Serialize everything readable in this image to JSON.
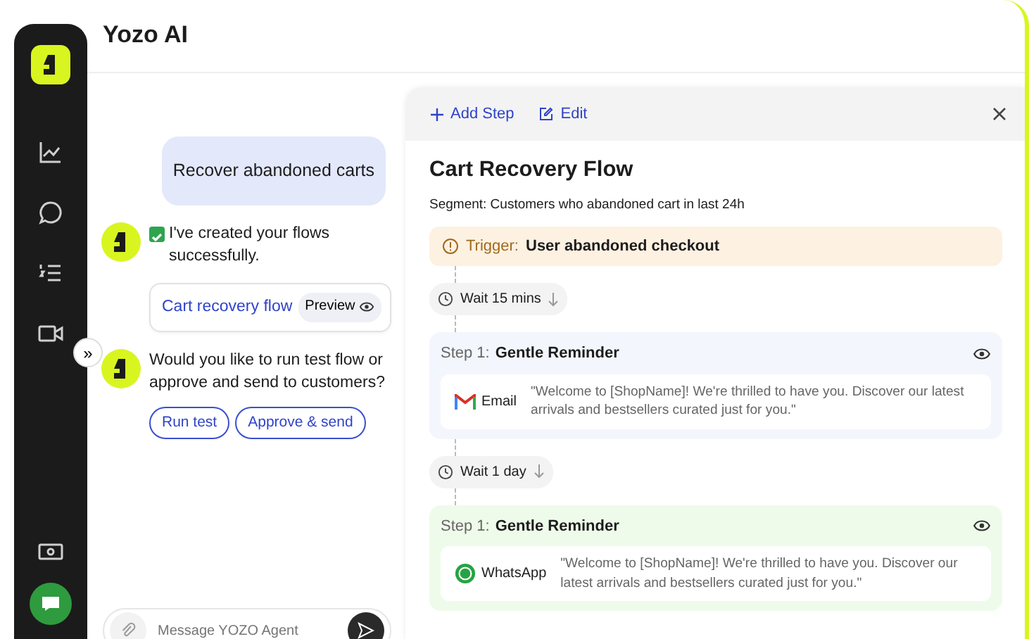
{
  "app": {
    "title": "Yozo AI",
    "expand_toggle": "»"
  },
  "chat": {
    "messages": [
      {
        "kind": "user",
        "text": "Recover abandoned carts"
      },
      {
        "kind": "bot",
        "text": "I've created your flows successfully.",
        "check": true,
        "flow_card": {
          "link": "Cart recovery flow",
          "preview": "Preview"
        }
      },
      {
        "kind": "bot",
        "text": " Would you like to run test flow or approve and send to customers?",
        "check": false,
        "actions": [
          "Run test",
          "Approve & send"
        ]
      }
    ],
    "input": {
      "placeholder": "Message YOZO Agent"
    }
  },
  "flow": {
    "toolbar": [
      "Add Step",
      "Edit"
    ],
    "title": "Cart Recovery Flow",
    "segment": "Segment: Customers who abandoned cart in last 24h",
    "trigger": {
      "label": "Trigger:",
      "value": "User abandoned checkout"
    },
    "items": [
      {
        "kind": "wait",
        "text": "Wait 15 mins"
      },
      {
        "kind": "step",
        "label": "Step 1:",
        "name": "Gentle Reminder",
        "channel": {
          "kind": "email",
          "label": "Email"
        },
        "message": "\"Welcome to [ShopName]! We're thrilled to have you. Discover our latest arrivals and bestsellers curated just for you.\""
      },
      {
        "kind": "wait",
        "text": "Wait 1 day"
      },
      {
        "kind": "step",
        "label": "Step 1:",
        "name": "Gentle Reminder",
        "channel": {
          "kind": "whatsapp",
          "label": "WhatsApp"
        },
        "message": "\"Welcome to [ShopName]! We're thrilled to have you. Discover our latest arrivals and bestsellers curated just for you.\""
      }
    ]
  }
}
